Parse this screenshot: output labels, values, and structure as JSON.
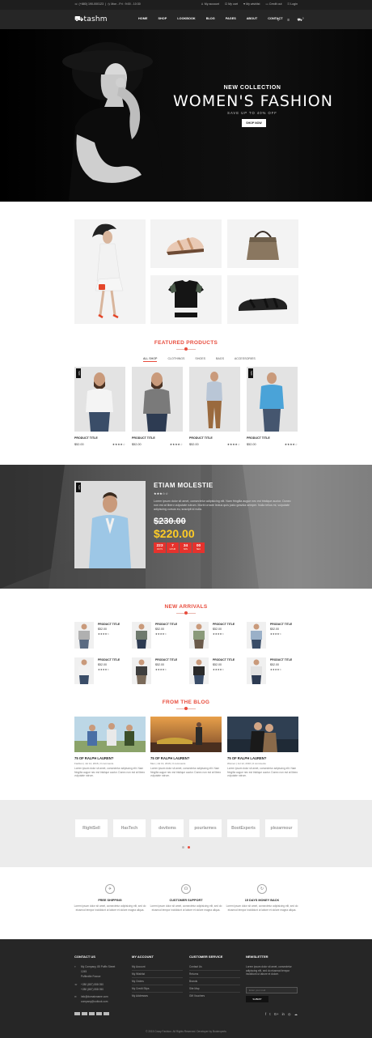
{
  "topbar": {
    "phone": "(+880) 190-000123",
    "hours": "Mon - Fri : 9:00 - 10:30",
    "links": [
      "My account",
      "My cart",
      "My wishlist",
      "Credit out",
      "Login"
    ]
  },
  "header": {
    "logo": "tashm",
    "nav": [
      "HOME",
      "SHOP",
      "LOOKBOOK",
      "BLOG",
      "PAGES",
      "ABOUT",
      "CONTACT"
    ],
    "cart_count": "0"
  },
  "hero": {
    "subtitle": "NEW COLLECTION",
    "title": "WOMEN'S FASHION",
    "tagline": "SAVE UP TO 40% OFF",
    "button": "SHOP NOW"
  },
  "featured": {
    "title": "FEATURED PRODUCTS",
    "tabs": [
      "ALL SHOP",
      "CLOTHINGS",
      "SHOES",
      "BAGS",
      "ACCESSORIES"
    ],
    "products": [
      {
        "badge": "NEW",
        "title": "PRODUCT TITLE",
        "price": "$52.00",
        "stars": "★★★★☆"
      },
      {
        "badge": "",
        "title": "PRODUCT TITLE",
        "price": "$52.00",
        "stars": "★★★★☆"
      },
      {
        "badge": "",
        "title": "PRODUCT TITLE",
        "price": "$52.00",
        "stars": "★★★★☆"
      },
      {
        "badge": "NEW",
        "title": "PRODUCT TITLE",
        "price": "$52.00",
        "stars": "★★★★☆"
      }
    ]
  },
  "deal": {
    "badge": "NEW",
    "name": "ETIAM MOLESTIE",
    "stars": "★★★☆☆",
    "desc": "Lorem ipsum dolor sit amet, consectetur adipisicing elit. Nam fringilla augue nec est tristique auctor. Donec non est at libero vulputate rutrum. Morbi ornare lectus quis justo gravida semper. Nulla tellus mi, vulputate adipiscing cursus eu, suscipit id nulla.",
    "old_price": "$230.00",
    "new_price": "$220.00",
    "timer": [
      {
        "n": "223",
        "l": "DAYS"
      },
      {
        "n": "7",
        "l": "HOUR"
      },
      {
        "n": "34",
        "l": "MIN"
      },
      {
        "n": "00",
        "l": "SEC"
      }
    ]
  },
  "arrivals": {
    "title": "NEW ARRIVALS",
    "items": [
      {
        "title": "PRODUCT TITLE",
        "price": "$52.00",
        "stars": "★★★★☆"
      },
      {
        "title": "PRODUCT TITLE",
        "price": "$52.00",
        "stars": "★★★★☆"
      },
      {
        "title": "PRODUCT TITLE",
        "price": "$52.00",
        "stars": "★★★★☆"
      },
      {
        "title": "PRODUCT TITLE",
        "price": "$52.00",
        "stars": "★★★★☆"
      },
      {
        "title": "PRODUCT TITLE",
        "price": "$52.00",
        "stars": "★★★★☆"
      },
      {
        "title": "PRODUCT TITLE",
        "price": "$52.00",
        "stars": "★★★★☆"
      },
      {
        "title": "PRODUCT TITLE",
        "price": "$52.00",
        "stars": "★★★★☆"
      },
      {
        "title": "PRODUCT TITLE",
        "price": "$52.00",
        "stars": "★★★★☆"
      }
    ]
  },
  "blog": {
    "title": "FROM THE BLOG",
    "posts": [
      {
        "title": "75 OF RALPH LAUREN?",
        "meta": "Fashion  |  Jul 14, 2016  |  0 comments",
        "desc": "Lorem ipsum dolor sit amet, consectetur adipiscing elit. Nam fringilla augue nec est tristique auctor. Donec non est at libero vulputate rutrum."
      },
      {
        "title": "75 OF RALPH LAUREN?",
        "meta": "Men  |  Jul 13, 2016  |  0 comments",
        "desc": "Lorem ipsum dolor sit amet, consectetur adipiscing elit. Nam fringilla augue nec est tristique auctor. Donec non est at libero vulputate rutrum."
      },
      {
        "title": "75 OF RALPH LAUREN?",
        "meta": "Women  |  Jul 12, 2016  |  0 comments",
        "desc": "Lorem ipsum dolor sit amet, consectetur adipiscing elit. Nam fringilla augue nec est tristique auctor. Donec non est at libero vulputate rutrum."
      }
    ]
  },
  "brands": [
    "RightSell",
    "HasTech",
    "devitems",
    "pourlarmes",
    "BootExperts",
    "plezarmour"
  ],
  "features": [
    {
      "title": "FREE SHIPPING",
      "desc": "Lorem ipsum dolor sit amet, consectetur adipisicing elit, sed do eiusmod tempor incididunt ut labore et dolore magna aliqua."
    },
    {
      "title": "CUSTOMER SUPPORT",
      "desc": "Lorem ipsum dolor sit amet, consectetur adipisicing elit, sed do eiusmod tempor incididunt ut labore et dolore magna aliqua."
    },
    {
      "title": "15 DAYS MONEY BACK",
      "desc": "Lorem ipsum dolor sit amet, consectetur adipisicing elit, sed do eiusmod tempor incididunt ut labore et dolore magna aliqua."
    }
  ],
  "footer": {
    "contact": {
      "title": "CONTACT US",
      "address": [
        "My Company, 85 Puffin Street",
        "1245",
        "Puffinville France"
      ],
      "phones": [
        "+280 (867) 558 050",
        "+280 (867) 558 050"
      ],
      "emails": [
        "info@domainname.com",
        "company@outlook.com"
      ]
    },
    "account": {
      "title": "MY ACCOUNT",
      "links": [
        "My Account",
        "My Wishlist",
        "My Orders",
        "My Credit Slips",
        "My Addresses"
      ]
    },
    "service": {
      "title": "CUSTOMER SERVICE",
      "links": [
        "Contact Us",
        "Returns",
        "Brands",
        "Site Map",
        "Gift Vouchers"
      ]
    },
    "newsletter": {
      "title": "NEWSLETTER",
      "desc": "Lorem ipsum dolor sit amet, consectetur adipiscing elit, sed do eiusmod tempor incididunt ut labore et dolore.",
      "placeholder": "Enter your mail",
      "button": "SUBMIT"
    },
    "social": [
      "f",
      "t",
      "G+",
      "in",
      "◎",
      "☁"
    ],
    "copyright": "© 2015 Crazy Fashion. All Rights Reserved. Developer by Bootexperts"
  }
}
